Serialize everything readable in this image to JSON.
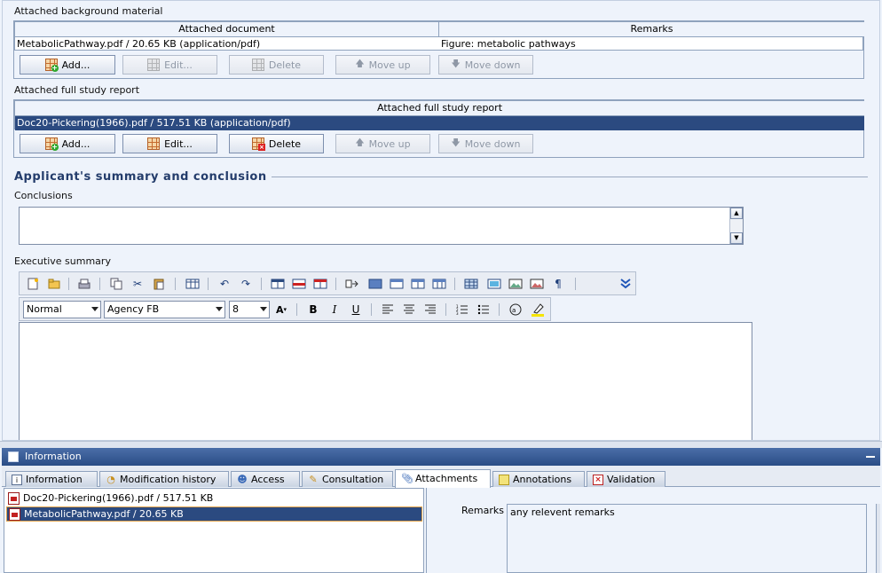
{
  "background_section": {
    "label": "Attached background material",
    "columns": [
      "Attached document",
      "Remarks"
    ],
    "rows": [
      {
        "document": "MetabolicPathway.pdf / 20.65 KB (application/pdf)",
        "remarks": "Figure: metabolic pathways"
      }
    ],
    "buttons": {
      "add": "Add...",
      "edit": "Edit...",
      "delete": "Delete",
      "move_up": "Move up",
      "move_down": "Move down"
    }
  },
  "full_report_section": {
    "label": "Attached full study report",
    "columns": [
      "Attached full study report"
    ],
    "rows": [
      {
        "document": "Doc20-Pickering(1966).pdf / 517.51 KB (application/pdf)"
      }
    ],
    "buttons": {
      "add": "Add...",
      "edit": "Edit...",
      "delete": "Delete",
      "move_up": "Move up",
      "move_down": "Move down"
    }
  },
  "summary_section": {
    "heading": "Applicant's summary and conclusion",
    "conclusions_label": "Conclusions",
    "conclusions_value": "",
    "executive_summary_label": "Executive summary",
    "style_select": "Normal",
    "font_select": "Agency FB",
    "size_select": "8",
    "editor_value": ""
  },
  "info_panel": {
    "title": "Information",
    "tabs": [
      {
        "label": "Information",
        "icon": "info-icon",
        "active": false
      },
      {
        "label": "Modification history",
        "icon": "history-icon",
        "active": false
      },
      {
        "label": "Access",
        "icon": "users-icon",
        "active": false
      },
      {
        "label": "Consultation",
        "icon": "pen-icon",
        "active": false
      },
      {
        "label": "Attachments",
        "icon": "paperclip-icon",
        "active": true
      },
      {
        "label": "Annotations",
        "icon": "note-icon",
        "active": false
      },
      {
        "label": "Validation",
        "icon": "validation-icon",
        "active": false
      }
    ],
    "attachments": [
      {
        "label": "Doc20-Pickering(1966).pdf / 517.51 KB",
        "selected": false
      },
      {
        "label": "MetabolicPathway.pdf / 20.65 KB",
        "selected": true
      }
    ],
    "remarks_label": "Remarks",
    "remarks_value": "any relevent remarks"
  },
  "colors": {
    "selection": "#2b4a80",
    "header_bar": "#2a4d86",
    "heading_text": "#233c6b"
  }
}
